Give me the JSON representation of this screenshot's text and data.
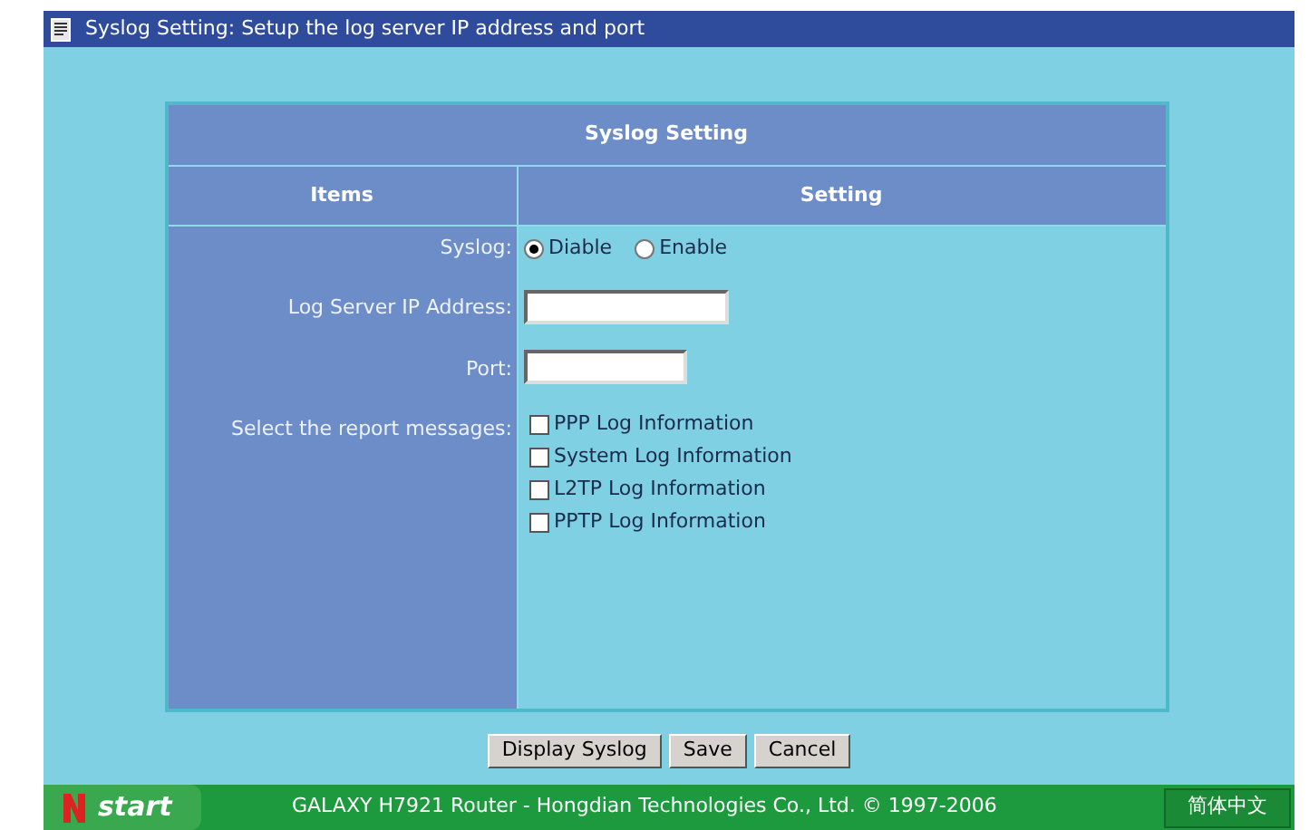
{
  "title_bar": {
    "title": "Syslog Setting: Setup the log server IP address and port"
  },
  "table": {
    "title": "Syslog Setting",
    "columns": [
      "Items",
      "Setting"
    ],
    "syslog": {
      "label": "Syslog:",
      "options": [
        {
          "label": "Diable",
          "selected": true
        },
        {
          "label": "Enable",
          "selected": false
        }
      ]
    },
    "ip_address": {
      "label": "Log Server IP Address:"
    },
    "port": {
      "label": "Port:"
    },
    "report_messages": {
      "label": "Select the report messages:",
      "options": [
        {
          "label": "PPP Log Information",
          "checked": false
        },
        {
          "label": "System Log Information",
          "checked": false
        },
        {
          "label": "L2TP Log Information",
          "checked": false
        },
        {
          "label": "PPTP Log Information",
          "checked": false
        }
      ]
    }
  },
  "buttons": [
    "Display Syslog",
    "Save",
    "Cancel"
  ],
  "footer": {
    "start": "start",
    "copyright": "GALAXY H7921 Router - Hongdian Technologies Co., Ltd. © 1997-2006",
    "language": "简体中文"
  }
}
